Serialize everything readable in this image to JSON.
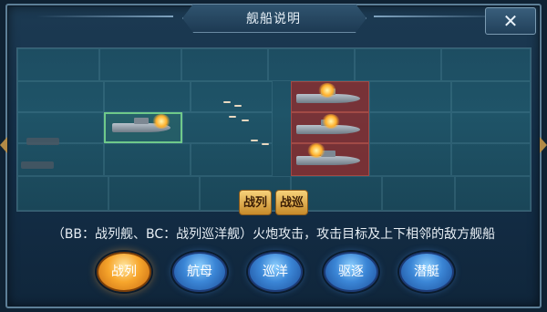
{
  "window": {
    "title": "舰船说明"
  },
  "arena": {
    "ship_labels": [
      "战列",
      "战巡"
    ]
  },
  "description": "（BB：战列舰、BC：战列巡洋舰）火炮攻击，攻击目标及上下相邻的敌方舰船",
  "tabs": [
    {
      "label": "战列",
      "active": true
    },
    {
      "label": "航母",
      "active": false
    },
    {
      "label": "巡洋",
      "active": false
    },
    {
      "label": "驱逐",
      "active": false
    },
    {
      "label": "潜艇",
      "active": false
    }
  ],
  "icons": {
    "close": "close-icon",
    "left_arrow": "chevron-left-icon",
    "right_arrow": "chevron-right-icon"
  },
  "colors": {
    "active_tab": "#f7a62c",
    "inactive_tab": "#3b86d6",
    "target_cell": "#962828",
    "selected_cell": "#6fc98a"
  }
}
